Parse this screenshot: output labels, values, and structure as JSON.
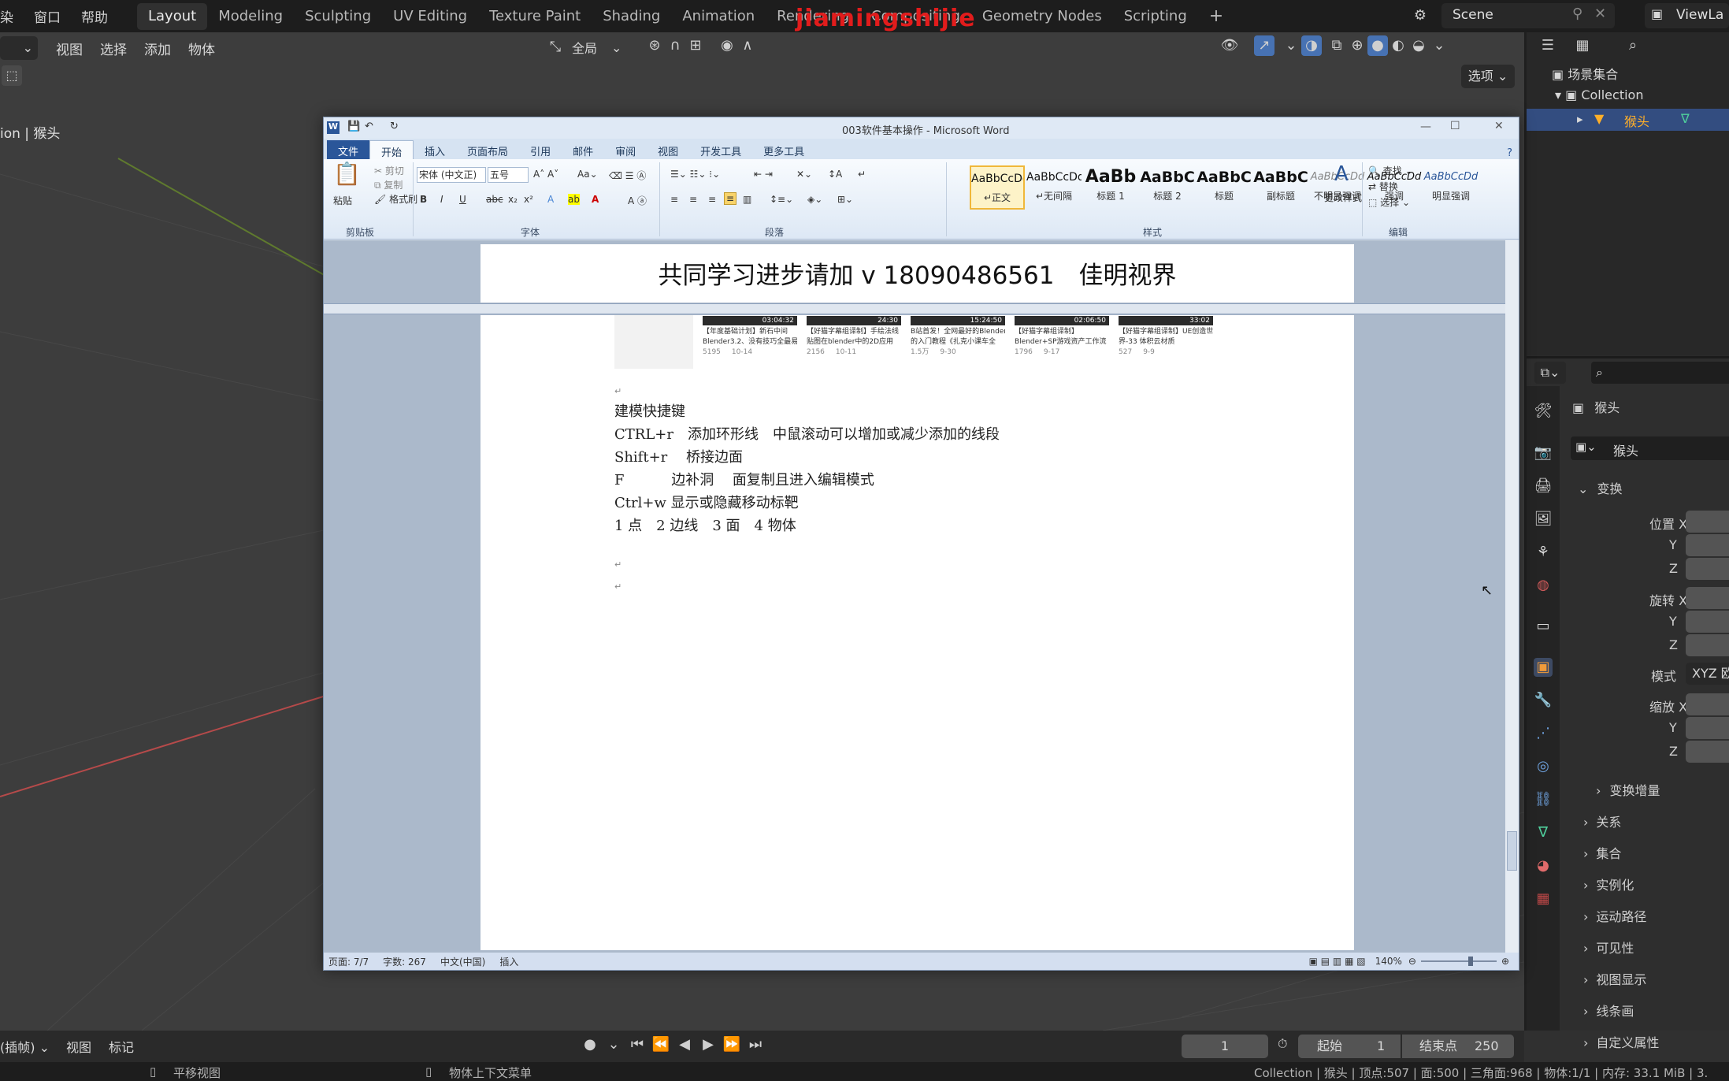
{
  "blender": {
    "top_menu": [
      "染",
      "窗口",
      "帮助"
    ],
    "workspaces": [
      "Layout",
      "Modeling",
      "Sculpting",
      "UV Editing",
      "Texture Paint",
      "Shading",
      "Animation",
      "Rendering",
      "Compositing",
      "Geometry Nodes",
      "Scripting"
    ],
    "active_workspace": "Layout",
    "add_workspace": "+",
    "watermark": "jiamingshijie",
    "scene": "Scene",
    "view_layer": "ViewLa",
    "viewport_menu": [
      "视图",
      "选择",
      "添加",
      "物体"
    ],
    "transform_orientation": "全局",
    "options_button": "选项",
    "viewport_overlay_text": "ion | 猴头",
    "outliner": {
      "scene_collection": "场景集合",
      "collection": "Collection",
      "object": "猴头"
    },
    "properties": {
      "object_name": "猴头",
      "data_name": "猴头",
      "transform_header": "变换",
      "location_label": "位置 X",
      "rotation_label": "旋转 X",
      "mode_label": "模式",
      "mode_value": "XYZ 欧",
      "scale_label": "缩放 X",
      "y": "Y",
      "z": "Z",
      "delta": "变换增量",
      "sections": [
        "关系",
        "集合",
        "实例化",
        "运动路径",
        "可见性",
        "视图显示",
        "线条画",
        "自定义属性"
      ]
    },
    "timeline": {
      "mode": "(插帧)",
      "menu": [
        "视图",
        "标记"
      ],
      "current_frame": "1",
      "start_label": "起始",
      "start_value": "1",
      "end_label": "结束点",
      "end_value": "250"
    },
    "status": {
      "left": "平移视图",
      "middle": "物体上下文菜单",
      "right": "Collection | 猴头 | 顶点:507 | 面:500 | 三角面:968 | 物体:1/1 | 内存: 33.1 MiB | 3."
    }
  },
  "word": {
    "title": "003软件基本操作 - Microsoft Word",
    "tabs": [
      "文件",
      "开始",
      "插入",
      "页面布局",
      "引用",
      "邮件",
      "审阅",
      "视图",
      "开发工具",
      "更多工具"
    ],
    "active_tab": "开始",
    "clipboard": {
      "paste": "粘贴",
      "cut": "剪切",
      "copy": "复制",
      "format_painter": "格式刷",
      "label": "剪贴板"
    },
    "font": {
      "name": "宋体 (中文正)",
      "size": "五号",
      "label": "字体"
    },
    "paragraph_label": "段落",
    "styles": [
      {
        "sample": "AaBbCcDd",
        "name": "↵正文"
      },
      {
        "sample": "AaBbCcDd",
        "name": "↵无间隔"
      },
      {
        "sample": "AaBb",
        "name": "标题 1"
      },
      {
        "sample": "AaBbC",
        "name": "标题 2"
      },
      {
        "sample": "AaBbC",
        "name": "标题"
      },
      {
        "sample": "AaBbC",
        "name": "副标题"
      },
      {
        "sample": "AaBbCcDd",
        "name": "不明显强调"
      },
      {
        "sample": "AaBbCcDd",
        "name": "强调"
      },
      {
        "sample": "AaBbCcDd",
        "name": "明显强调"
      }
    ],
    "styles_label": "样式",
    "change_styles": "更改样式",
    "editing": {
      "find": "查找",
      "replace": "替换",
      "select": "选择",
      "label": "编辑"
    },
    "header_text": "共同学习进步请加 v 18090486561　佳明视界",
    "thumbnails": [
      {
        "time": "03:04:32",
        "title1": "【年度基础计划】新石中间",
        "title2": "Blender3.2、没有技巧全最易",
        "views": "5195",
        "date": "10-14"
      },
      {
        "time": "24:30",
        "title1": "【好猫字幕组译制】手绘法线",
        "title2": "贴图在blender中的2D应用",
        "views": "2156",
        "date": "10-11"
      },
      {
        "time": "15:24:50",
        "title1": "B站首发！全网最好的Blender",
        "title2": "的入门教程《扎克小课车全",
        "views": "1.5万",
        "date": "9-30"
      },
      {
        "time": "02:06:50",
        "title1": "【好猫字幕组译制】",
        "title2": "Blender+SP游戏资产工作流",
        "views": "1796",
        "date": "9-17"
      },
      {
        "time": "33:02",
        "title1": "【好猫字幕组译制】UE创造世",
        "title2": "界-33 体积云材质",
        "views": "527",
        "date": "9-9"
      }
    ],
    "body_lines": [
      "建模快捷键",
      "CTRL+r　添加环形线　中鼠滚动可以增加或减少添加的线段",
      "Shift+r　 桥接边面",
      "F　　　 边补洞　 面复制且进入编辑模式",
      "Ctrl+w  显示或隐藏移动标靶",
      "1 点　2 边线　3 面　4 物体"
    ],
    "status": {
      "page": "页面: 7/7",
      "words": "字数: 267",
      "lang": "中文(中国)",
      "mode": "插入",
      "zoom": "140%"
    }
  }
}
